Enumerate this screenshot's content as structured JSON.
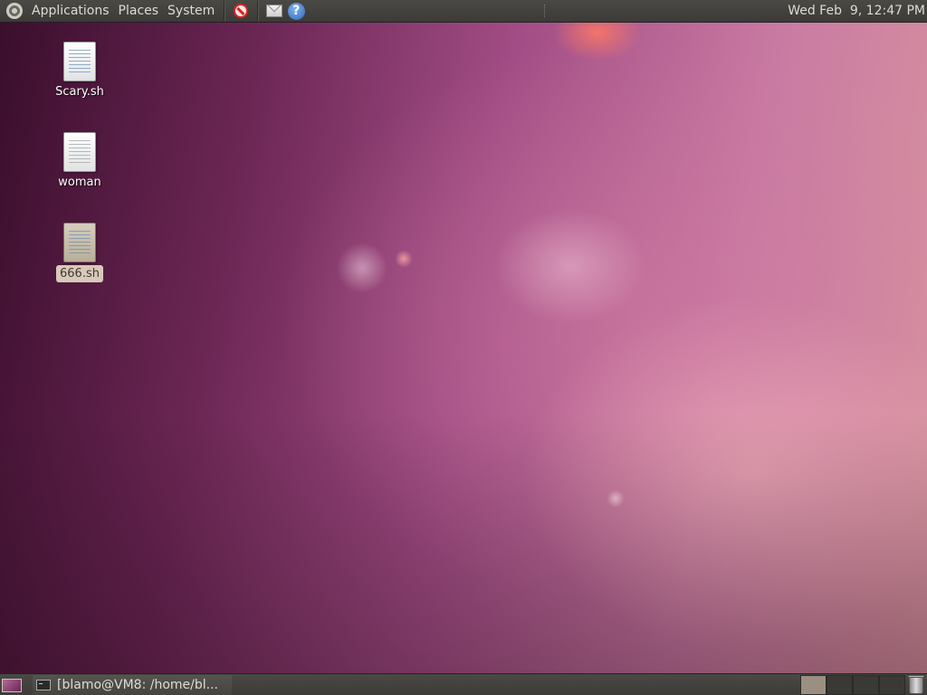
{
  "top_panel": {
    "menus": {
      "applications": "Applications",
      "places": "Places",
      "system": "System"
    },
    "launchers": [
      "no-entry-icon",
      "mail-icon",
      "help-icon"
    ],
    "help_glyph": "?",
    "clock": "Wed Feb  9, 12:47 PM"
  },
  "desktop": {
    "icons": [
      {
        "label": "Scary.sh",
        "type": "script",
        "selected": false
      },
      {
        "label": "woman",
        "type": "text",
        "selected": false
      },
      {
        "label": "666.sh",
        "type": "script",
        "selected": true
      }
    ]
  },
  "bottom_panel": {
    "task": {
      "title": "[blamo@VM8: /home/bl..."
    },
    "workspaces": {
      "count": 4,
      "active_index": 0
    }
  },
  "colors": {
    "panel": "#3c3b37",
    "panel_text": "#dfdbd2",
    "selection": "#d9c9b8"
  }
}
